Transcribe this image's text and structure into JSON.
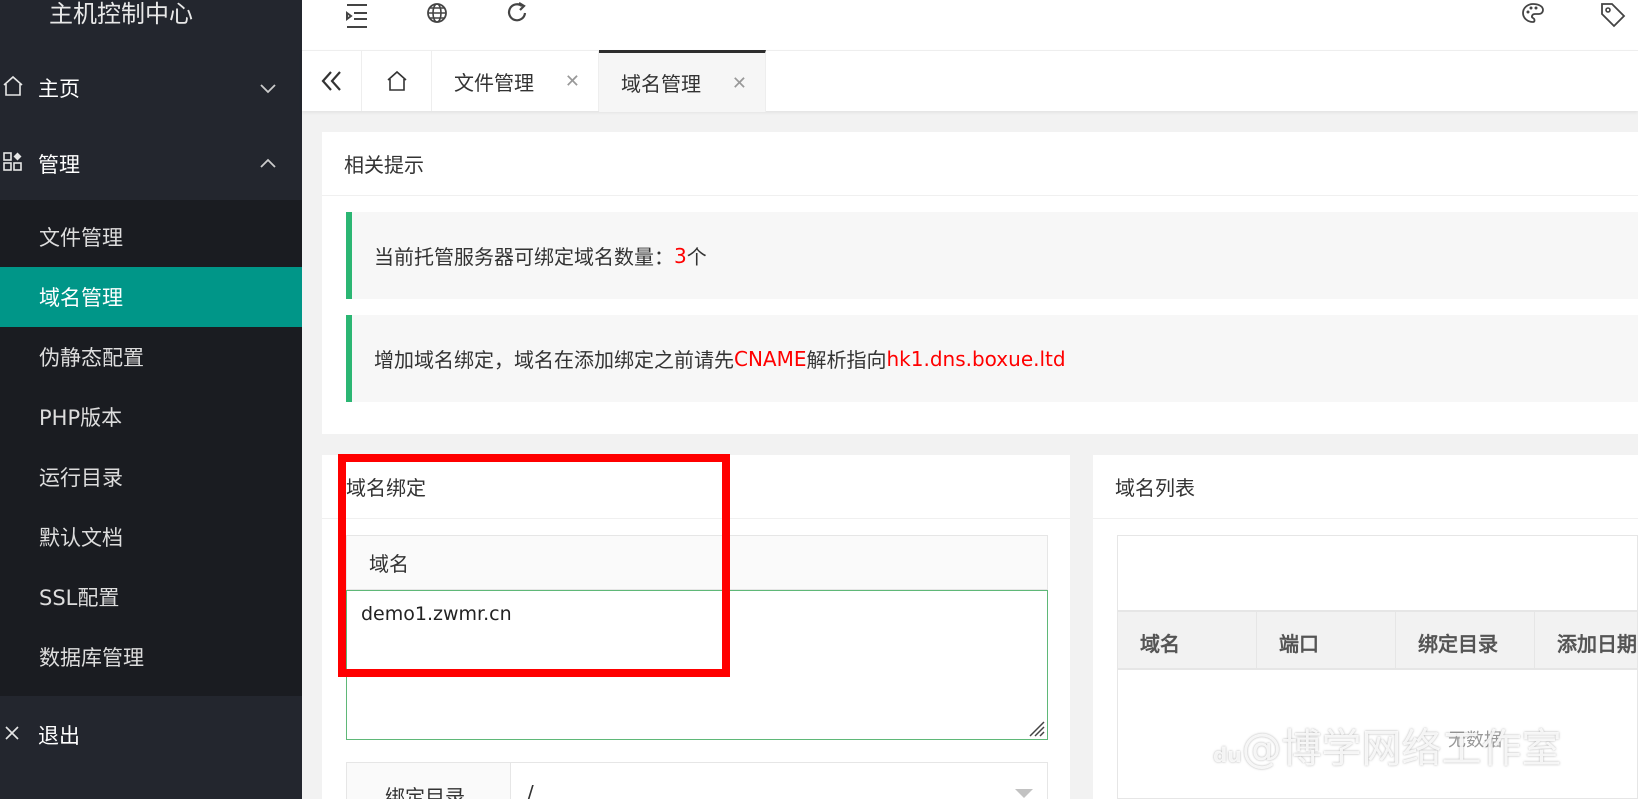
{
  "sidebar": {
    "brand": "主机控制中心",
    "home": "主页",
    "manage": "管理",
    "submenu": [
      "文件管理",
      "域名管理",
      "伪静态配置",
      "PHP版本",
      "运行目录",
      "默认文档",
      "SSL配置",
      "数据库管理"
    ],
    "logout": "退出"
  },
  "tabs": {
    "items": [
      {
        "label": "文件管理"
      },
      {
        "label": "域名管理"
      }
    ],
    "close_glyph": "✕"
  },
  "tips": {
    "title": "相关提示",
    "line1_prefix": "当前托管服务器可绑定域名数量：",
    "line1_count": "3",
    "line1_suffix": "个",
    "line2_prefix": "增加域名绑定，域名在添加绑定之前请先",
    "line2_cname": "CNAME",
    "line2_middle": "解析指向",
    "line2_target": "hk1.dns.boxue.ltd"
  },
  "bind": {
    "title": "域名绑定",
    "domain_label": "域名",
    "domain_value": "demo1.zwmr.cn",
    "dir_label": "绑定目录",
    "dir_value": "/"
  },
  "list": {
    "title": "域名列表",
    "columns": [
      "域名",
      "端口",
      "绑定目录",
      "添加日期"
    ],
    "empty_text": "无数据"
  },
  "watermark": {
    "logo": "du",
    "text": "@博学网络工作室"
  },
  "colors": {
    "accent": "#009688",
    "sidebar_bg": "#23262e",
    "notice_border": "#2bb673",
    "highlight": "#ff0000"
  }
}
